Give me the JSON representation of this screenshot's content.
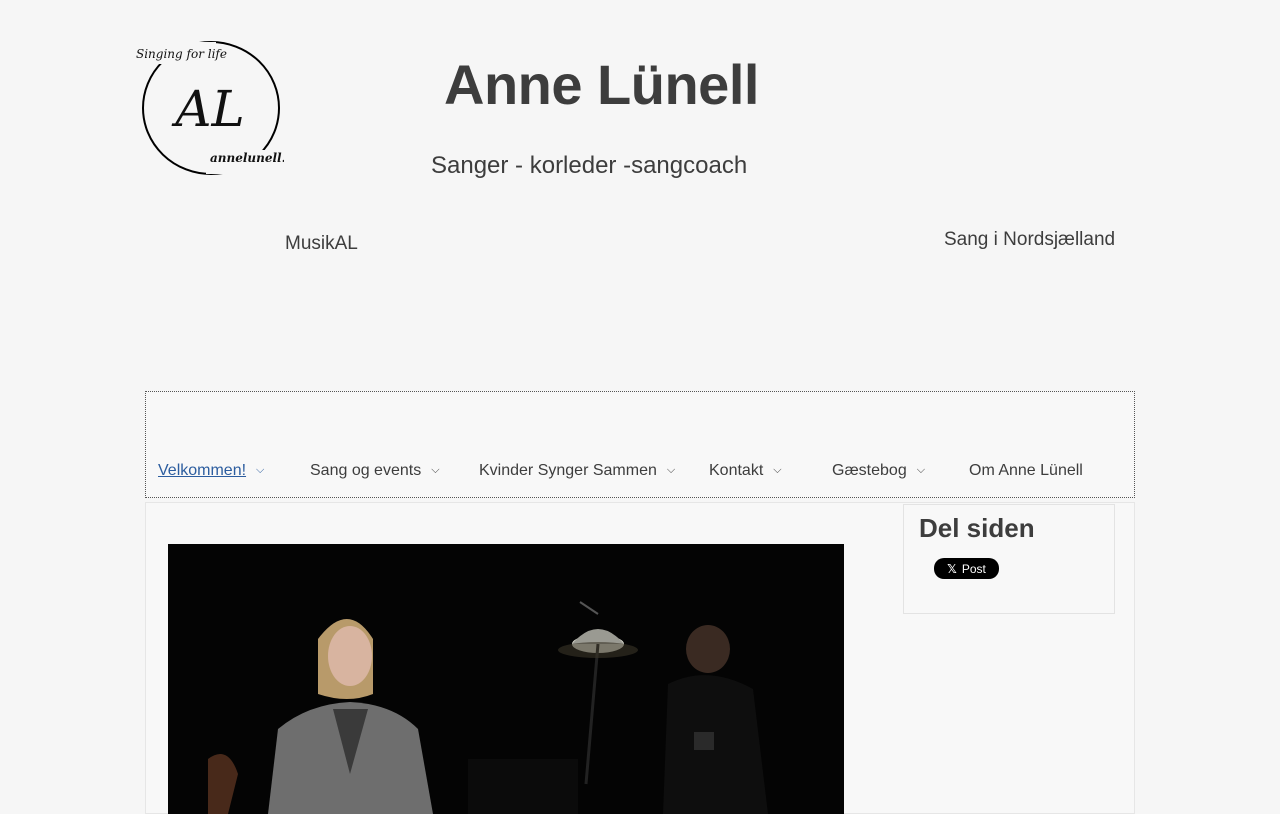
{
  "logo": {
    "tagline": "Singing for life",
    "monogram": "AL",
    "domain": "annelunell.dk"
  },
  "header": {
    "title": "Anne Lünell",
    "subtitle": "Sanger - korleder -sangcoach"
  },
  "taglines": {
    "left": "MusikAL",
    "right": "Sang i Nordsjælland"
  },
  "nav": {
    "items": [
      {
        "label": "Velkommen!",
        "has_dropdown": true,
        "active": true
      },
      {
        "label": "Sang og events",
        "has_dropdown": true
      },
      {
        "label": "Kvinder Synger Sammen",
        "has_dropdown": true
      },
      {
        "label": "Kontakt",
        "has_dropdown": true
      },
      {
        "label": "Gæstebog",
        "has_dropdown": true
      },
      {
        "label": "Om Anne Lünell",
        "has_dropdown": false
      }
    ]
  },
  "sidebar": {
    "title": "Del siden",
    "share_button": {
      "label": "Post",
      "icon": "x-logo-icon"
    }
  },
  "colors": {
    "active_link": "#2c5d9f",
    "text": "#3d3d3d",
    "background": "#f6f6f6"
  }
}
